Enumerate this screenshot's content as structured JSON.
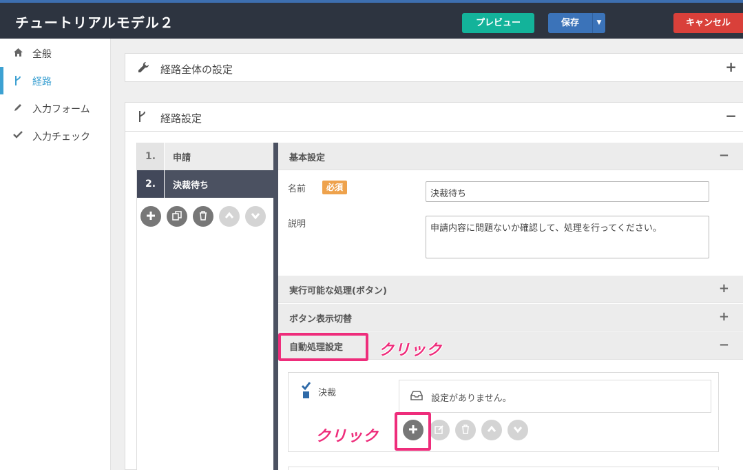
{
  "header": {
    "title": "チュートリアルモデル２",
    "preview_label": "プレビュー",
    "save_label": "保存",
    "cancel_label": "キャンセル"
  },
  "sidebar": {
    "items": [
      {
        "label": "全般",
        "icon": "home-icon"
      },
      {
        "label": "経路",
        "icon": "route-icon",
        "active": true
      },
      {
        "label": "入力フォーム",
        "icon": "pencil-icon"
      },
      {
        "label": "入力チェック",
        "icon": "check-icon"
      }
    ]
  },
  "panels": {
    "route_overall": {
      "title": "経路全体の設定",
      "toggle": "+"
    },
    "route_settings": {
      "title": "経路設定",
      "toggle": "−"
    }
  },
  "steps": [
    {
      "num": "1.",
      "name": "申請"
    },
    {
      "num": "2.",
      "name": "決裁待ち"
    }
  ],
  "detail": {
    "basic": {
      "title": "基本設定",
      "toggle": "−"
    },
    "name_label": "名前",
    "required_badge": "必須",
    "name_value": "決裁待ち",
    "desc_label": "説明",
    "desc_value": "申請内容に問題ないか確認して、処理を行ってください。",
    "actions": {
      "title": "実行可能な処理(ボタン)",
      "toggle": "+"
    },
    "button_display": {
      "title": "ボタン表示切替",
      "toggle": "+"
    },
    "auto_process": {
      "title": "自動処理設定",
      "toggle": "−"
    },
    "decision_label": "決裁",
    "empty_message": "設定がありません。"
  },
  "annotations": {
    "click_1": "クリック",
    "click_2": "クリック"
  },
  "colors": {
    "header_bg": "#2d3440",
    "preview": "#13b39a",
    "save": "#3b73b9",
    "cancel": "#d9403a",
    "accent": "#3da1d2",
    "highlight": "#ee2d7b",
    "required": "#eea24c"
  }
}
